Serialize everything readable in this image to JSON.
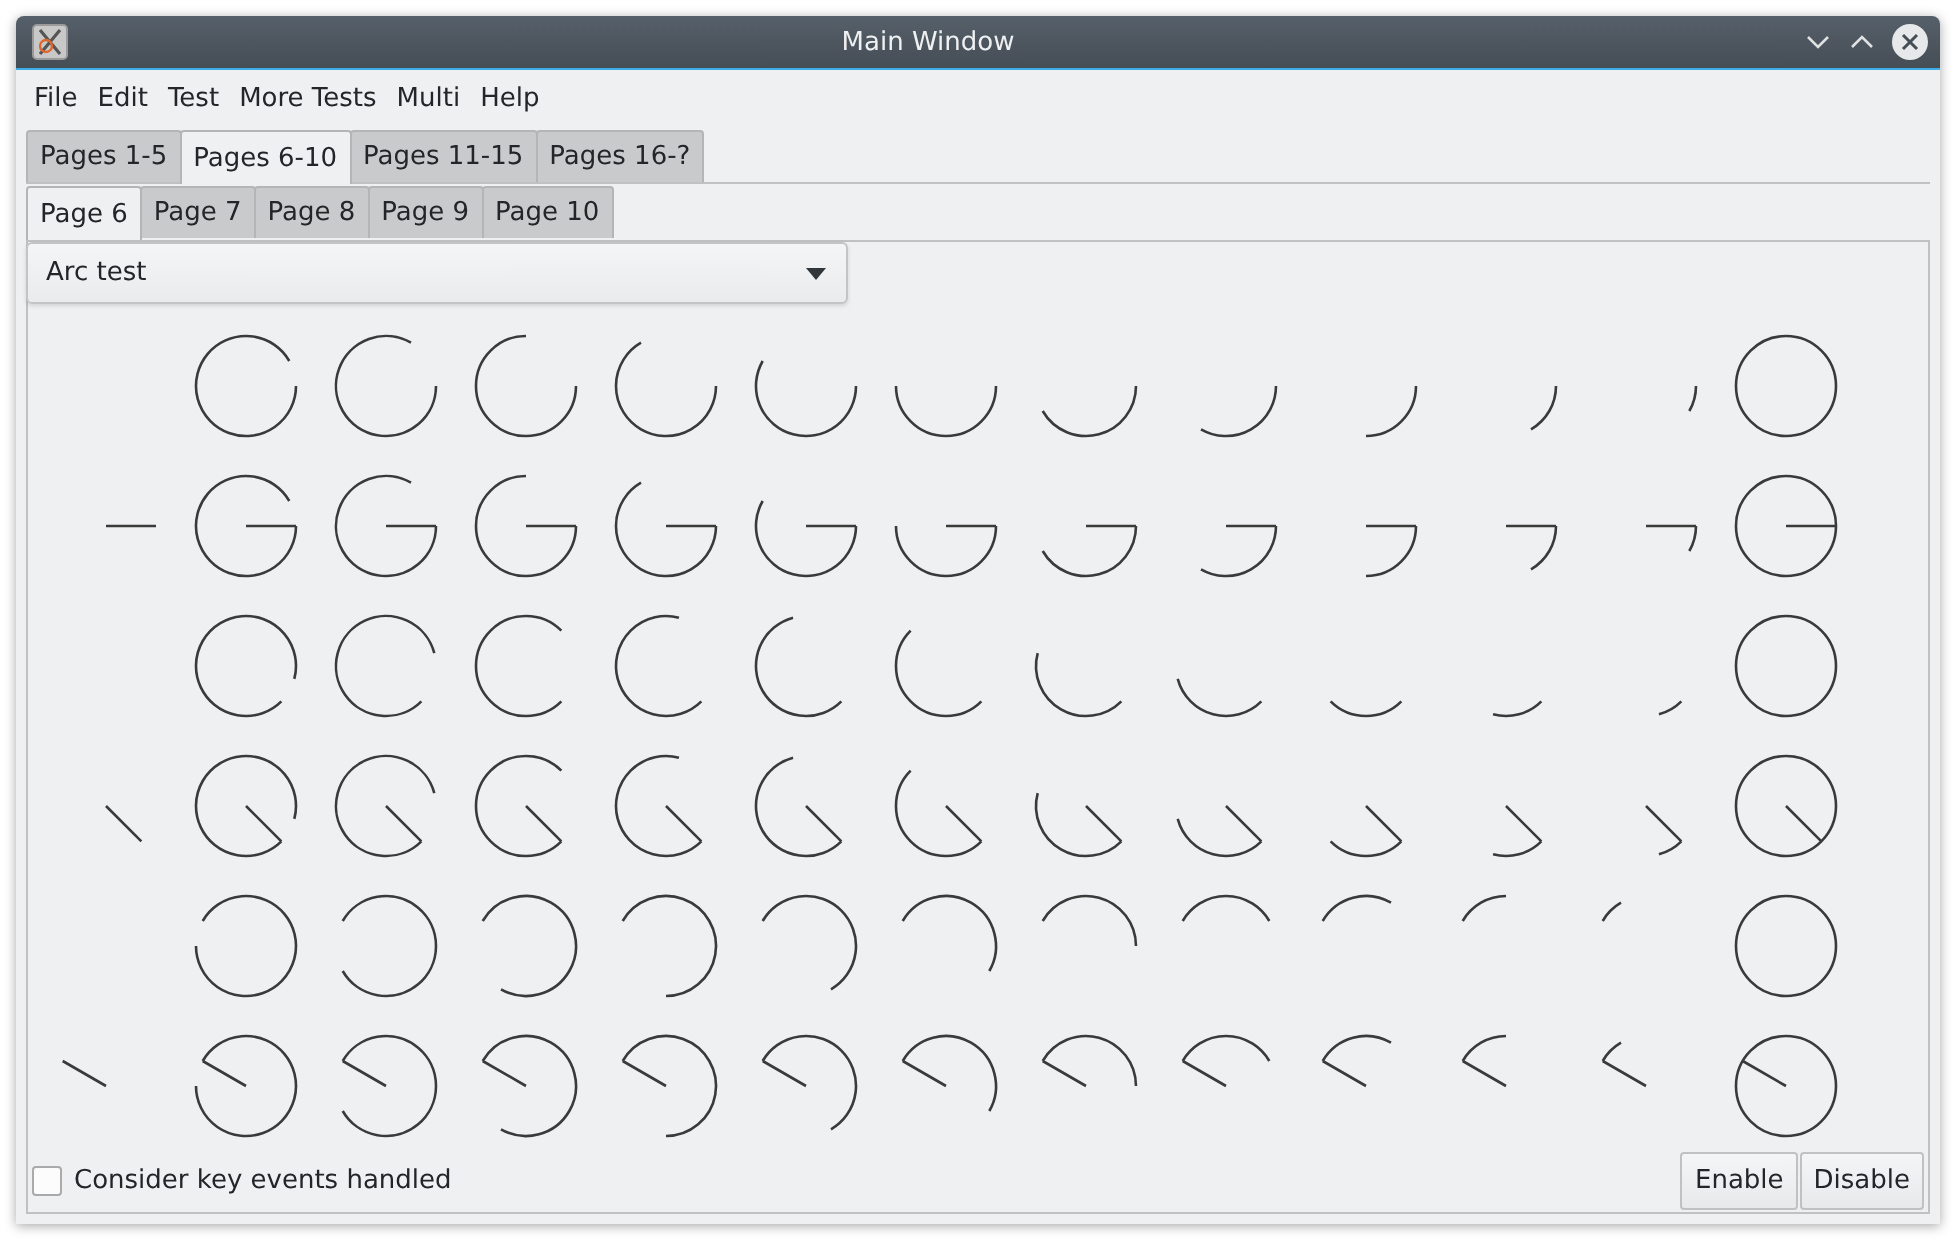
{
  "window": {
    "title": "Main Window"
  },
  "menu": [
    "File",
    "Edit",
    "Test",
    "More Tests",
    "Multi",
    "Help"
  ],
  "outer_tabs": [
    {
      "label": "Pages 1-5",
      "selected": false
    },
    {
      "label": "Pages 6-10",
      "selected": true
    },
    {
      "label": "Pages 11-15",
      "selected": false
    },
    {
      "label": "Pages 16-?",
      "selected": false
    }
  ],
  "inner_tabs": [
    {
      "label": "Page 6",
      "selected": true
    },
    {
      "label": "Page 7",
      "selected": false
    },
    {
      "label": "Page 8",
      "selected": false
    },
    {
      "label": "Page 9",
      "selected": false
    },
    {
      "label": "Page 10",
      "selected": false
    }
  ],
  "dropdown": {
    "value": "Arc test"
  },
  "checkbox": {
    "label": "Consider key events handled",
    "checked": false
  },
  "buttons": [
    "Enable",
    "Disable"
  ]
}
